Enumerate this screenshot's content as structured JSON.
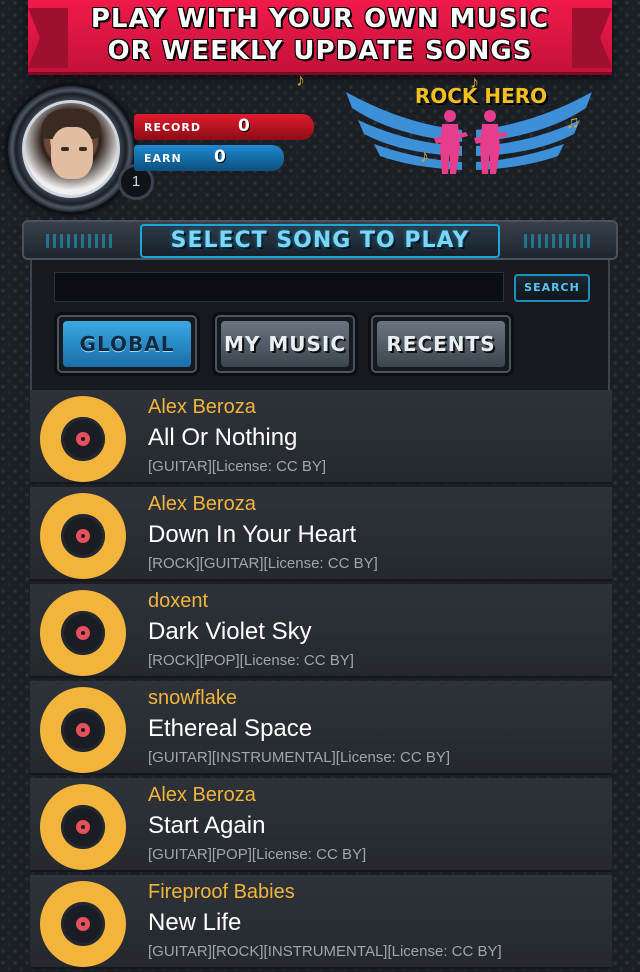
{
  "banner": {
    "line1": "PLAY WITH YOUR OWN MUSIC",
    "line2": "OR WEEKLY UPDATE SONGS"
  },
  "profile": {
    "record_label": "RECORD",
    "record_value": "0",
    "earn_label": "EARN",
    "earn_value": "0",
    "level": "1"
  },
  "logo": {
    "text": "ROCK HERO"
  },
  "panel": {
    "title": "SELECT SONG TO PLAY",
    "search_placeholder": "",
    "search_button": "SEARCH",
    "tabs": [
      {
        "label": "GLOBAL",
        "active": true
      },
      {
        "label": "MY MUSIC",
        "active": false
      },
      {
        "label": "RECENTS",
        "active": false
      }
    ]
  },
  "songs": [
    {
      "artist": "Alex Beroza",
      "title": "All Or Nothing",
      "tags": "[GUITAR][License: CC BY]"
    },
    {
      "artist": "Alex Beroza",
      "title": "Down In Your Heart",
      "tags": "[ROCK][GUITAR][License: CC BY]"
    },
    {
      "artist": "doxent",
      "title": "Dark Violet Sky",
      "tags": "[ROCK][POP][License: CC BY]"
    },
    {
      "artist": "snowflake",
      "title": "Ethereal Space",
      "tags": "[GUITAR][INSTRUMENTAL][License: CC BY]"
    },
    {
      "artist": "Alex Beroza",
      "title": "Start Again",
      "tags": "[GUITAR][POP][License: CC BY]"
    },
    {
      "artist": "Fireproof Babies",
      "title": "New Life",
      "tags": "[GUITAR][ROCK][INSTRUMENTAL][License: CC BY]"
    }
  ]
}
